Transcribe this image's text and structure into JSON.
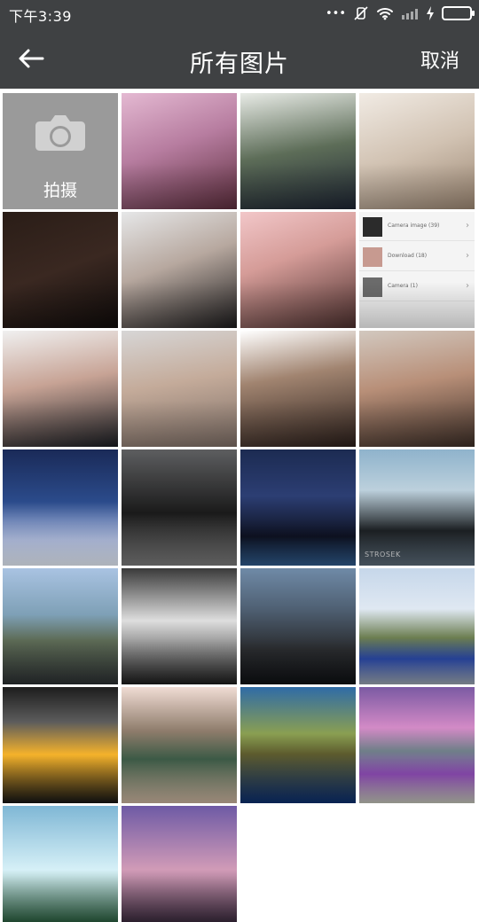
{
  "status_bar": {
    "time": "下午3:39",
    "icons": [
      "more-dots-icon",
      "muted-vibrate-icon",
      "wifi-icon",
      "signal-icon",
      "charging-bolt-icon",
      "battery-icon"
    ],
    "more_dots": "•••"
  },
  "nav": {
    "back_icon": "arrow-left-icon",
    "title": "所有图片",
    "cancel_label": "取消"
  },
  "camera_tile": {
    "icon": "camera-icon",
    "label": "拍摄"
  },
  "gallery": {
    "tiles": [
      {
        "name": "photo-1"
      },
      {
        "name": "photo-2"
      },
      {
        "name": "photo-3"
      },
      {
        "name": "photo-4"
      },
      {
        "name": "photo-5"
      },
      {
        "name": "photo-6"
      },
      {
        "name": "photo-7-screenshot"
      },
      {
        "name": "photo-8"
      },
      {
        "name": "photo-9"
      },
      {
        "name": "photo-10"
      },
      {
        "name": "photo-11"
      },
      {
        "name": "photo-12"
      },
      {
        "name": "photo-13"
      },
      {
        "name": "photo-14"
      },
      {
        "name": "photo-15"
      },
      {
        "name": "photo-16"
      },
      {
        "name": "photo-17"
      },
      {
        "name": "photo-18"
      },
      {
        "name": "photo-19"
      },
      {
        "name": "photo-20"
      },
      {
        "name": "photo-21"
      },
      {
        "name": "photo-22"
      },
      {
        "name": "photo-23"
      },
      {
        "name": "photo-24"
      },
      {
        "name": "photo-25"
      }
    ]
  },
  "screenshot_tile": {
    "rows": [
      {
        "label": "Camera image (39)"
      },
      {
        "label": "Download (18)"
      },
      {
        "label": "Camera (1)"
      }
    ],
    "chevron": "›"
  },
  "overlays": {
    "car_label_1": "STROSEK"
  },
  "colors": {
    "bar_background": "#3f4143",
    "camera_tile_background": "#9a9a9a",
    "battery_green": "#29c54c"
  }
}
